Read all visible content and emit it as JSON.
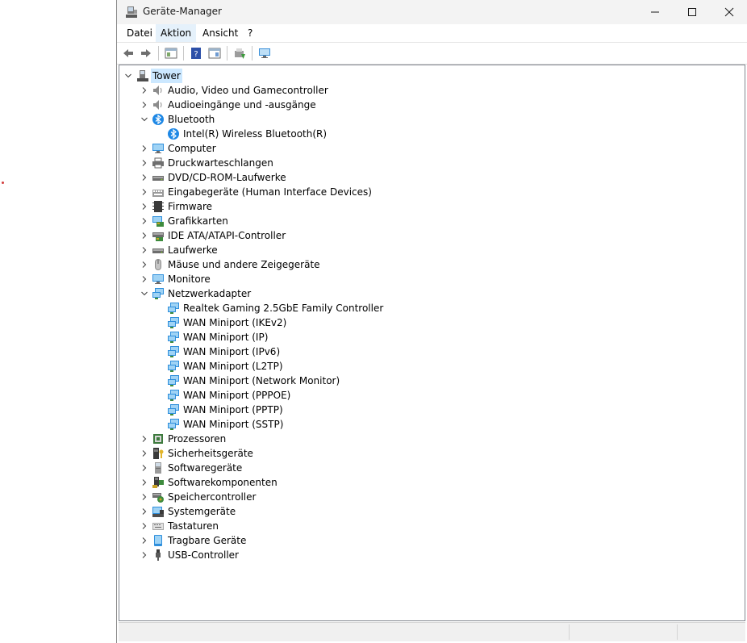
{
  "window": {
    "title": "Geräte-Manager"
  },
  "menu": {
    "items": [
      "Datei",
      "Aktion",
      "Ansicht",
      "?"
    ]
  },
  "tree": {
    "root": "Tower",
    "nodes": [
      {
        "label": "Audio, Video und Gamecontroller",
        "icon": "speaker-icon",
        "expanded": false
      },
      {
        "label": "Audioeingänge und -ausgänge",
        "icon": "speaker-icon",
        "expanded": false
      },
      {
        "label": "Bluetooth",
        "icon": "bluetooth-icon",
        "expanded": true,
        "children": [
          "Intel(R) Wireless Bluetooth(R)"
        ]
      },
      {
        "label": "Computer",
        "icon": "monitor-icon",
        "expanded": false
      },
      {
        "label": "Druckwarteschlangen",
        "icon": "printer-icon",
        "expanded": false
      },
      {
        "label": "DVD/CD-ROM-Laufwerke",
        "icon": "drive-icon",
        "expanded": false
      },
      {
        "label": "Eingabegeräte (Human Interface Devices)",
        "icon": "hid-icon",
        "expanded": false
      },
      {
        "label": "Firmware",
        "icon": "chip-icon",
        "expanded": false
      },
      {
        "label": "Grafikkarten",
        "icon": "display-adapter-icon",
        "expanded": false
      },
      {
        "label": "IDE ATA/ATAPI-Controller",
        "icon": "ide-controller-icon",
        "expanded": false
      },
      {
        "label": "Laufwerke",
        "icon": "drive-icon",
        "expanded": false
      },
      {
        "label": "Mäuse und andere Zeigegeräte",
        "icon": "mouse-icon",
        "expanded": false
      },
      {
        "label": "Monitore",
        "icon": "monitor-icon",
        "expanded": false
      },
      {
        "label": "Netzwerkadapter",
        "icon": "network-adapter-icon",
        "expanded": true,
        "children": [
          "Realtek Gaming 2.5GbE Family Controller",
          "WAN Miniport (IKEv2)",
          "WAN Miniport (IP)",
          "WAN Miniport (IPv6)",
          "WAN Miniport (L2TP)",
          "WAN Miniport (Network Monitor)",
          "WAN Miniport (PPPOE)",
          "WAN Miniport (PPTP)",
          "WAN Miniport (SSTP)"
        ]
      },
      {
        "label": "Prozessoren",
        "icon": "processor-icon",
        "expanded": false
      },
      {
        "label": "Sicherheitsgeräte",
        "icon": "security-device-icon",
        "expanded": false
      },
      {
        "label": "Softwaregeräte",
        "icon": "software-device-icon",
        "expanded": false
      },
      {
        "label": "Softwarekomponenten",
        "icon": "software-component-icon",
        "expanded": false
      },
      {
        "label": "Speichercontroller",
        "icon": "storage-controller-icon",
        "expanded": false
      },
      {
        "label": "Systemgeräte",
        "icon": "system-device-icon",
        "expanded": false
      },
      {
        "label": "Tastaturen",
        "icon": "keyboard-icon",
        "expanded": false
      },
      {
        "label": "Tragbare Geräte",
        "icon": "portable-device-icon",
        "expanded": false
      },
      {
        "label": "USB-Controller",
        "icon": "usb-icon",
        "expanded": false
      }
    ]
  },
  "colors": {
    "selection": "#cce8ff",
    "menu_active": "#e5f1fb",
    "titlebar": "#f3f3f3",
    "accent_blue": "#1e88e5"
  }
}
